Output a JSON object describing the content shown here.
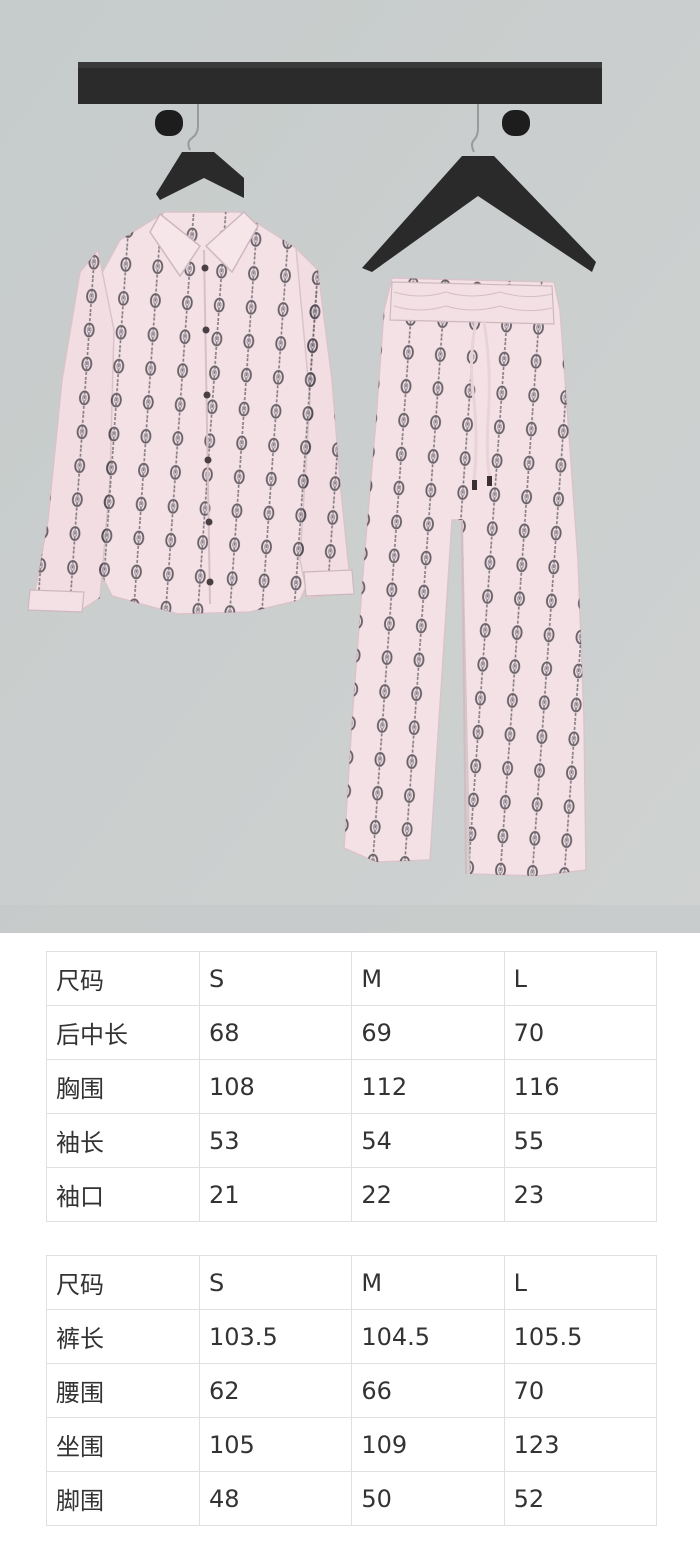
{
  "photo": {
    "subject": "pink-chain-print-shirt-and-wide-leg-trousers",
    "colors": {
      "wall": "#c9cdcd",
      "fabric": "#f4e1e6",
      "print": "#5e5a5e",
      "rail": "#2b2b2b",
      "hanger": "#2a2a2a"
    }
  },
  "top_table": {
    "header": [
      "尺码",
      "S",
      "M",
      "L"
    ],
    "rows": [
      [
        "后中长",
        "68",
        "69",
        "70"
      ],
      [
        "胸围",
        "108",
        "112",
        "116"
      ],
      [
        "袖长",
        "53",
        "54",
        "55"
      ],
      [
        "袖口",
        "21",
        "22",
        "23"
      ]
    ]
  },
  "bottom_table": {
    "header": [
      "尺码",
      "S",
      "M",
      "L"
    ],
    "rows": [
      [
        "裤长",
        "103.5",
        "104.5",
        "105.5"
      ],
      [
        "腰围",
        "62",
        "66",
        "70"
      ],
      [
        "坐围",
        "105",
        "109",
        "123"
      ],
      [
        "脚围",
        "48",
        "50",
        "52"
      ]
    ]
  }
}
